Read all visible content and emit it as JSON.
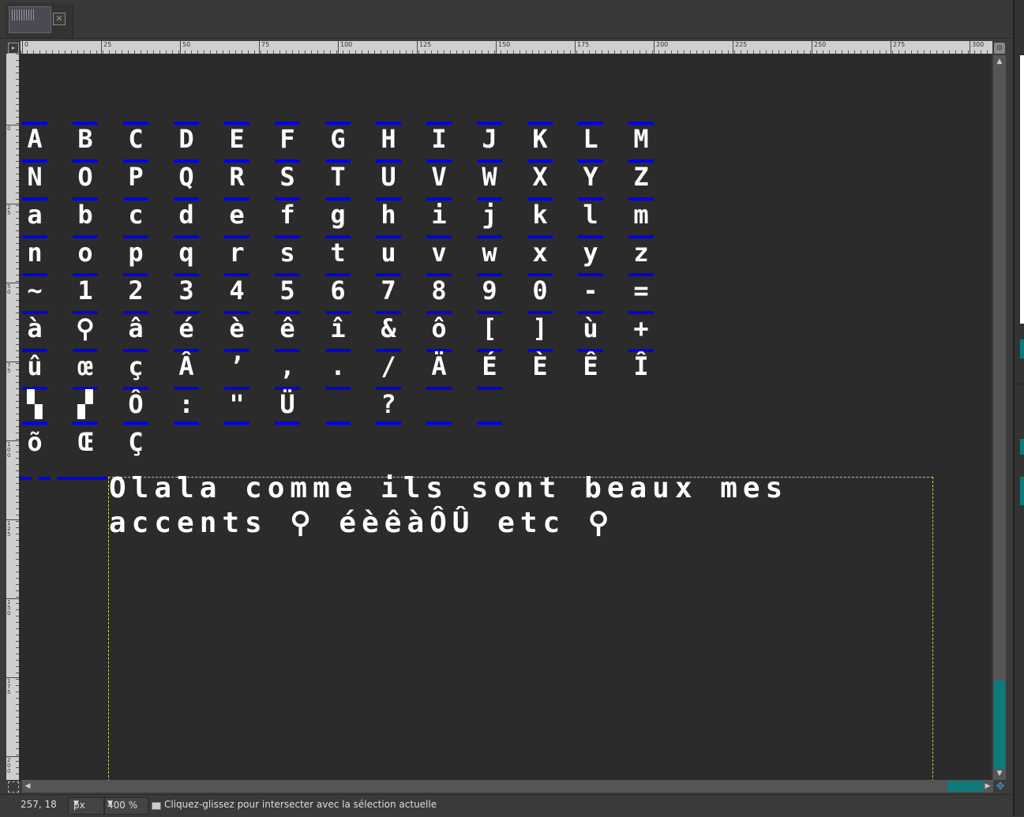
{
  "ruler": {
    "horizontal_labels": [
      "0",
      "25",
      "50",
      "75",
      "100",
      "125",
      "150",
      "175",
      "200",
      "225",
      "250",
      "275",
      "300"
    ],
    "vertical_labels": [
      "0",
      "25",
      "50",
      "75",
      "100",
      "125",
      "150",
      "175",
      "200"
    ]
  },
  "canvas": {
    "glyph_rows": [
      [
        "A",
        "B",
        "C",
        "D",
        "E",
        "F",
        "G",
        "H",
        "I",
        "J",
        "K",
        "L",
        "M"
      ],
      [
        "N",
        "O",
        "P",
        "Q",
        "R",
        "S",
        "T",
        "U",
        "V",
        "W",
        "X",
        "Y",
        "Z"
      ],
      [
        "a",
        "b",
        "c",
        "d",
        "e",
        "f",
        "g",
        "h",
        "i",
        "j",
        "k",
        "l",
        "m"
      ],
      [
        "n",
        "o",
        "p",
        "q",
        "r",
        "s",
        "t",
        "u",
        "v",
        "w",
        "x",
        "y",
        "z"
      ],
      [
        "~",
        "1",
        "2",
        "3",
        "4",
        "5",
        "6",
        "7",
        "8",
        "9",
        "0",
        "-",
        "="
      ],
      [
        "à",
        "⚲",
        "â",
        "é",
        "è",
        "ê",
        "î",
        "&",
        "ô",
        "[",
        "]",
        "ù",
        "+"
      ],
      [
        "û",
        "œ",
        "ç",
        "Â",
        "’",
        ",",
        ".",
        "/",
        "Ä",
        "É",
        "È",
        "Ê",
        "Î"
      ],
      [
        "▚",
        "▞",
        "Ô",
        ":",
        "\"",
        "Ü",
        "",
        "?",
        "",
        "",
        "",
        "",
        ""
      ],
      [
        "õ",
        "Œ",
        "Ç",
        "",
        "",
        "",
        "",
        "",
        "",
        "",
        "",
        "",
        ""
      ]
    ],
    "text_line_1": "Olala comme ils sont beaux mes",
    "text_line_2": "accents ⚲ éèêàÔÛ etc ⚲",
    "accent_color": "#0000ee",
    "selection_color": "#d8d060"
  },
  "tab": {
    "close_icon": "✕"
  },
  "statusbar": {
    "coordinates": "257, 18",
    "unit": "px",
    "zoom": "400 %",
    "message": "Cliquez-glissez pour intersecter avec la sélection actuelle"
  },
  "colors": {
    "scroll_thumb": "#0e7a7a"
  }
}
